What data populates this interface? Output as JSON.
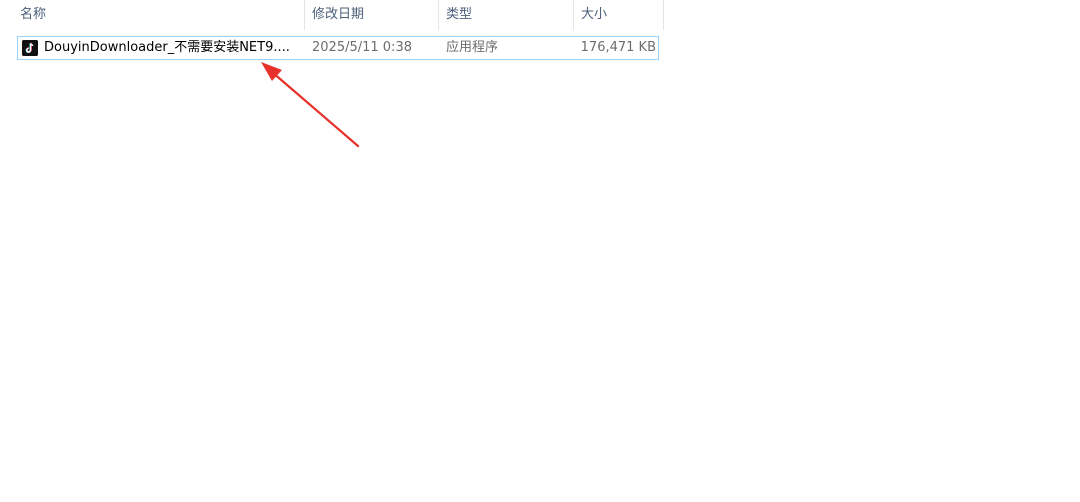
{
  "columns": {
    "name": "名称",
    "date_modified": "修改日期",
    "type": "类型",
    "size": "大小"
  },
  "sort": {
    "column": "name",
    "icon": "caret-up-icon"
  },
  "files": [
    {
      "icon": "douyin-app-icon",
      "name": "DouyinDownloader_不需要安装NET9....",
      "date_modified": "2025/5/11 0:38",
      "type": "应用程序",
      "size": "176,471 KB"
    }
  ],
  "colors": {
    "selection_border": "#99d1ff",
    "header_text": "#4c607a",
    "annotation_arrow": "#e8312a"
  }
}
